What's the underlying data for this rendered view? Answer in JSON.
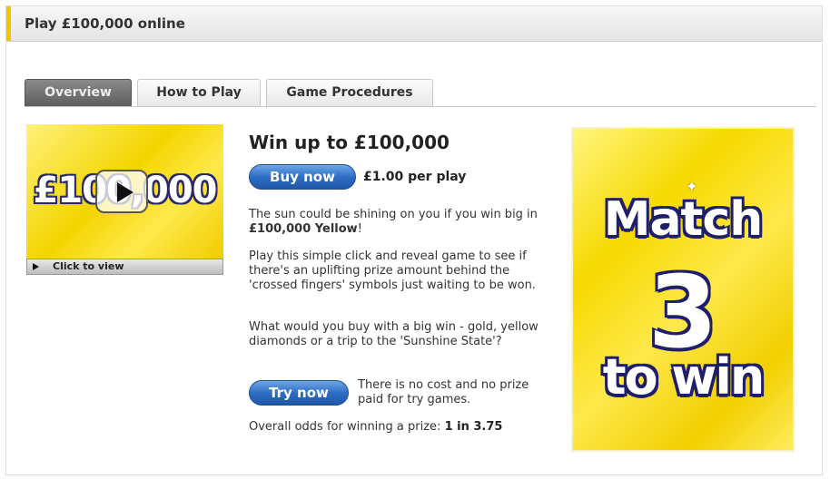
{
  "header": {
    "title": "Play £100,000 online"
  },
  "tabs": [
    {
      "label": "Overview",
      "active": true
    },
    {
      "label": "How to Play",
      "active": false
    },
    {
      "label": "Game Procedures",
      "active": false
    }
  ],
  "video": {
    "thumbnail_text": "£100,000",
    "bar_label": "Click to view",
    "icon": "play-icon"
  },
  "content": {
    "heading": "Win up to £100,000",
    "buy_button": "Buy now",
    "price": "£1.00 per play",
    "para1_text": "The sun could be shining on you if you win big in ",
    "para1_bold": "£100,000 Yellow",
    "para1_end": "!",
    "para2": "Play this simple click and reveal game to see if there's an uplifting prize amount behind the 'crossed fingers' symbols just waiting to be won.",
    "para3": "What would you buy with a big win - gold, yellow diamonds or a trip to the 'Sunshine State'?",
    "try_button": "Try now",
    "try_note": "There is no cost and no prize paid for try games.",
    "odds_label": "Overall odds for winning a prize: ",
    "odds_value": "1 in 3.75"
  },
  "banner": {
    "line1": "Match",
    "line2": "3",
    "line3": "to win"
  },
  "colors": {
    "accent": "#f2c400",
    "button_blue": "#2f6ec4",
    "banner_yellow": "#f6d900"
  }
}
